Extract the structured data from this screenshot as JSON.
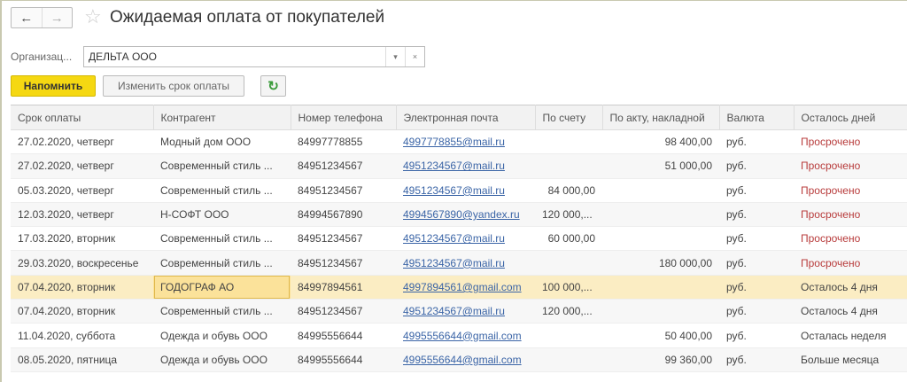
{
  "header": {
    "title": "Ожидаемая оплата от покупателей",
    "back": "←",
    "forward": "→"
  },
  "filter": {
    "label": "Организац...",
    "value": "ДЕЛЬТА ООО",
    "dropdown": "▾",
    "clear": "×"
  },
  "toolbar": {
    "remind": "Напомнить",
    "change_due": "Изменить срок оплаты",
    "refresh": "↻"
  },
  "columns": [
    "Срок оплаты",
    "Контрагент",
    "Номер телефона",
    "Электронная почта",
    "По счету",
    "По акту, накладной",
    "Валюта",
    "Осталось дней"
  ],
  "rows": [
    [
      "27.02.2020, четверг",
      "Модный дом ООО",
      "84997778855",
      "4997778855@mail.ru",
      "",
      "98 400,00",
      "руб.",
      "Просрочено"
    ],
    [
      "27.02.2020, четверг",
      "Современный стиль ...",
      "84951234567",
      "4951234567@mail.ru",
      "",
      "51 000,00",
      "руб.",
      "Просрочено"
    ],
    [
      "05.03.2020, четверг",
      "Современный стиль ...",
      "84951234567",
      "4951234567@mail.ru",
      "84 000,00",
      "",
      "руб.",
      "Просрочено"
    ],
    [
      "12.03.2020, четверг",
      "Н-СОФТ ООО",
      "84994567890",
      "4994567890@yandex.ru",
      "120 000,...",
      "",
      "руб.",
      "Просрочено"
    ],
    [
      "17.03.2020, вторник",
      "Современный стиль ...",
      "84951234567",
      "4951234567@mail.ru",
      "60 000,00",
      "",
      "руб.",
      "Просрочено"
    ],
    [
      "29.03.2020, воскресенье",
      "Современный стиль ...",
      "84951234567",
      "4951234567@mail.ru",
      "",
      "180 000,00",
      "руб.",
      "Просрочено"
    ],
    [
      "07.04.2020, вторник",
      "ГОДОГРАФ АО",
      "84997894561",
      "4997894561@gmail.com",
      "100 000,...",
      "",
      "руб.",
      "Осталось 4 дня"
    ],
    [
      "07.04.2020, вторник",
      "Современный стиль ...",
      "84951234567",
      "4951234567@mail.ru",
      "120 000,...",
      "",
      "руб.",
      "Осталось 4 дня"
    ],
    [
      "11.04.2020, суббота",
      "Одежда и обувь ООО",
      "84995556644",
      "4995556644@gmail.com",
      "",
      "50 400,00",
      "руб.",
      "Осталась неделя"
    ],
    [
      "08.05.2020, пятница",
      "Одежда и обувь ООО",
      "84995556644",
      "4995556644@gmail.com",
      "",
      "99 360,00",
      "руб.",
      "Больше месяца"
    ]
  ],
  "selected_row": 6
}
